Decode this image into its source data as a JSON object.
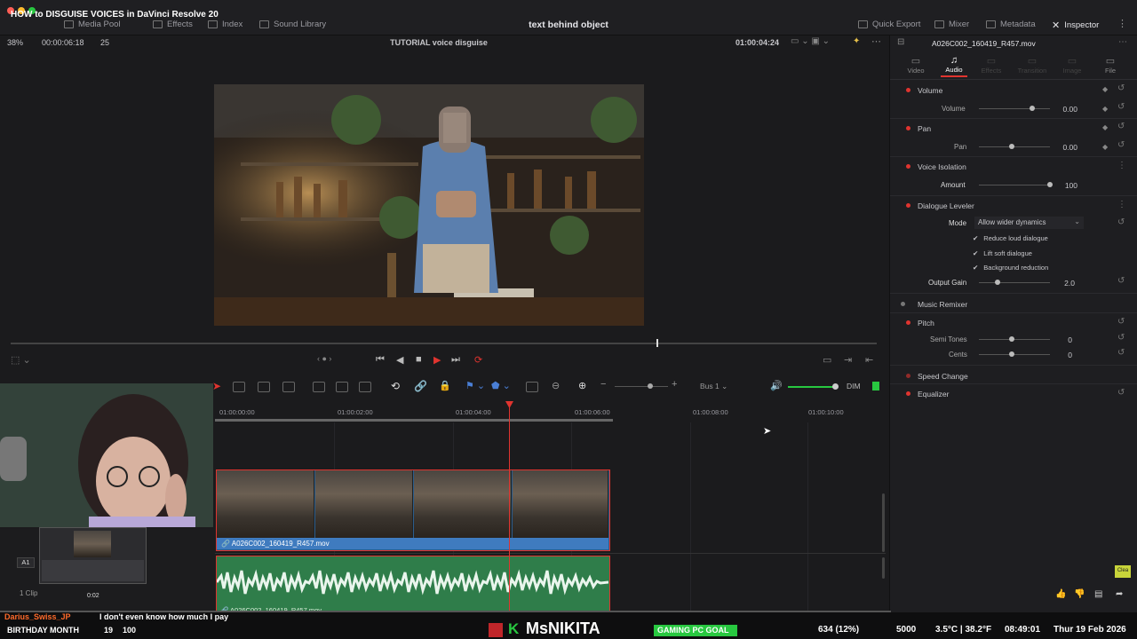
{
  "window": {
    "title": "HOW to DISGUISE VOICES in DaVinci Resolve 20",
    "center_title": "text behind object"
  },
  "toolbar": {
    "media_pool": "Media Pool",
    "effects": "Effects",
    "index": "Index",
    "sound_library": "Sound Library",
    "quick_export": "Quick Export",
    "mixer": "Mixer",
    "metadata": "Metadata",
    "inspector": "Inspector"
  },
  "viewer": {
    "zoom": "38%",
    "duration": "00:00:06:18",
    "fps": "25",
    "timeline_name": "TUTORIAL voice disguise",
    "timecode": "01:00:04:24",
    "clip_name": "A026C002_160419_R457.mov"
  },
  "timeline": {
    "ruler": [
      "01:00:00:00",
      "01:00:02:00",
      "01:00:04:00",
      "01:00:06:00",
      "01:00:08:00",
      "01:00:10:00"
    ],
    "bus": "Bus 1",
    "dim": "DIM",
    "video_clip_name": "A026C002_160419_R457.mov",
    "audio_clip_name": "A026C002_160419_R457.mov",
    "track_a1": "A1",
    "clip_count": "1 Clip",
    "preview_time": "0:02"
  },
  "inspector": {
    "tabs": [
      "Video",
      "Audio",
      "Effects",
      "Transition",
      "Image",
      "File"
    ],
    "active_tab": "Audio",
    "volume_header": "Volume",
    "volume_label": "Volume",
    "volume_value": "0.00",
    "pan_header": "Pan",
    "pan_label": "Pan",
    "pan_value": "0.00",
    "voice_isolation_header": "Voice Isolation",
    "amount_label": "Amount",
    "amount_value": "100",
    "dialogue_leveler_header": "Dialogue Leveler",
    "mode_label": "Mode",
    "mode_value": "Allow wider dynamics",
    "check1": "Reduce loud dialogue",
    "check2": "Lift soft dialogue",
    "check3": "Background reduction",
    "output_gain_label": "Output Gain",
    "output_gain_value": "2.0",
    "music_remixer_header": "Music Remixer",
    "pitch_header": "Pitch",
    "semi_tones_label": "Semi Tones",
    "semi_tones_value": "0",
    "cents_label": "Cents",
    "cents_value": "0",
    "speed_change_header": "Speed Change",
    "equalizer_header": "Equalizer",
    "clear_badge": "Clea"
  },
  "stream": {
    "chat_user": "Darius_Swiss_JP",
    "chat_message": "I don't even know how much I pay",
    "birthday": "BIRTHDAY MONTH",
    "birthday_count": "19",
    "birthday_goal": "100",
    "channel": "MsNIKITA",
    "gaming_goal": "GAMING PC GOAL",
    "goal_progress": "634 (12%)",
    "goal_target": "5000",
    "weather": "3.5°C | 38.2°F",
    "time": "08:49:01",
    "date": "Thur 19 Feb 2026"
  },
  "colors": {
    "accent_red": "#e0342f",
    "video_clip": "#2b5d8c",
    "audio_clip": "#2f7d4a",
    "panel_bg": "#1e1e21"
  }
}
